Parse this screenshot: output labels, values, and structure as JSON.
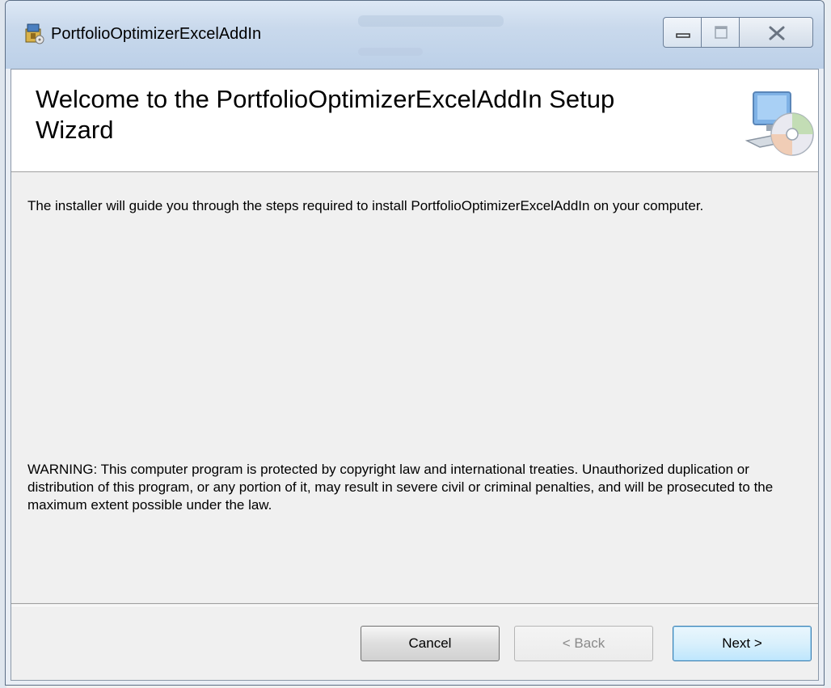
{
  "window": {
    "title": "PortfolioOptimizerExcelAddIn"
  },
  "banner": {
    "title": "Welcome to the PortfolioOptimizerExcelAddIn Setup Wizard",
    "icon": "computer-cd-icon"
  },
  "body": {
    "intro": "The installer will guide you through the steps required to install PortfolioOptimizerExcelAddIn on your computer.",
    "warning": "WARNING: This computer program is protected by copyright law and international treaties. Unauthorized duplication or distribution of this program, or any portion of it, may result in severe civil or criminal penalties, and will be prosecuted to the maximum extent possible under the law."
  },
  "buttons": {
    "cancel": "Cancel",
    "back": "< Back",
    "next": "Next >"
  },
  "colors": {
    "accent_next": "#3c7fb1",
    "titlebar": "#c9d9ec"
  }
}
